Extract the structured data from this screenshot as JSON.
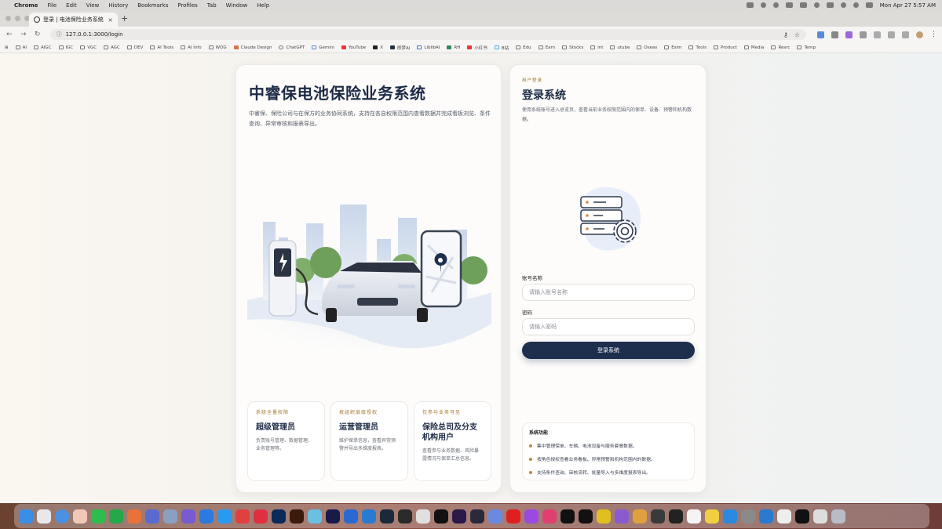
{
  "menubar": {
    "app": "Chrome",
    "items": [
      "File",
      "Edit",
      "View",
      "History",
      "Bookmarks",
      "Profiles",
      "Tab",
      "Window",
      "Help"
    ],
    "datetime": "Mon Apr 27  5:57 AM"
  },
  "browser": {
    "tab_title": "登录 | 电池保险业务系统",
    "url": "127.0.0.1:3000/login",
    "bookmarks": [
      "AI",
      "AIGC",
      "IGC",
      "VGC",
      "AGC",
      "DEV",
      "AI Tools",
      "AI Info",
      "WOG",
      "Claude Design",
      "ChatGPT",
      "Gemini",
      "YouTube",
      "X",
      "即梦AI",
      "LiblibAI",
      "RH",
      "小红书",
      "B站",
      "Edu",
      "Earn",
      "Stocks",
      "int",
      "utube",
      "Oseas",
      "Esim",
      "Tools",
      "Product",
      "Media",
      "Resrc",
      "Temp"
    ]
  },
  "hero": {
    "title": "中睿保电池保险业务系统",
    "description": "中睿保、保险公司与在保方的业务协同系统，支持在各自权限范围内查看数据并完成看板浏览、条件查询、异常审核和报表导出。"
  },
  "roles": [
    {
      "tag": "系统全量权限",
      "title": "超级管理员",
      "desc": "负责账号管理、数据管理、业务管理等。"
    },
    {
      "tag": "按组织层级授权",
      "title": "运营管理员",
      "desc": "维护保单信息，查看异常预警并导出多维度报表。"
    },
    {
      "tag": "仅参与业务可见",
      "title": "保险总司及分支机构用户",
      "desc": "查看参与业务数据、风险暴露情况与保单汇总信息。"
    }
  ],
  "login": {
    "kicker": "用户登录",
    "title": "登录系统",
    "description": "使用系统账号进入总览页，查看当前业务权限范围内的保单、设备、预警和机构数据。",
    "account_label": "账号名称",
    "account_placeholder": "请输入账号名称",
    "password_label": "密码",
    "password_placeholder": "请输入密码",
    "submit_label": "登录系统"
  },
  "features": {
    "title": "系统功能",
    "items": [
      "集中管理保单、车辆、电池设备与服务套餐数据。",
      "按角色授权查看业务看板、异常预警和机构范围内的数据。",
      "支持条件查询、审核流转、批量导入与多维度报表导出。"
    ]
  },
  "colors": {
    "navy": "#1d2f4d",
    "gold": "#a4762b",
    "dot": "#c08a3b"
  }
}
